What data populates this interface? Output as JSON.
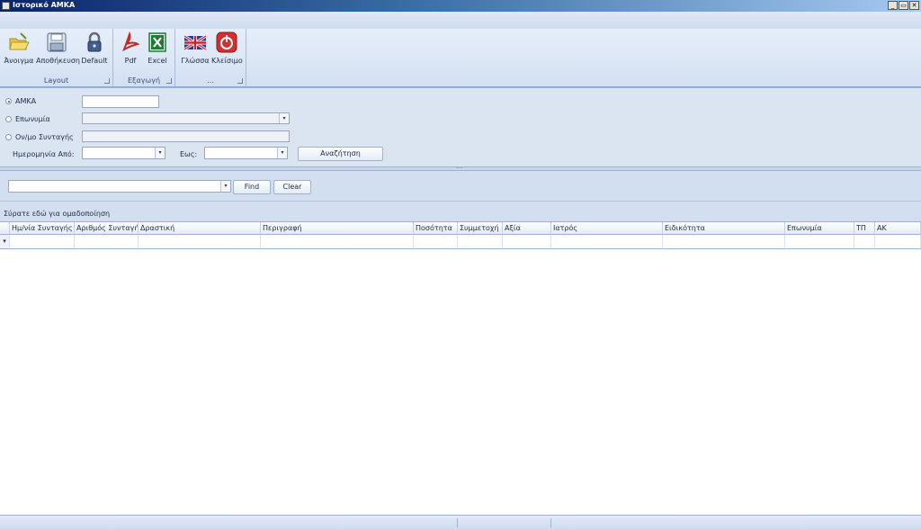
{
  "window": {
    "title": "Ιστορικό ΑΜΚΑ",
    "controls": [
      "_",
      "▭",
      "✕"
    ]
  },
  "ribbon": {
    "groups": [
      {
        "label": "Layout",
        "buttons": [
          {
            "label": "Άνοιγμα",
            "icon": "folder-open-icon"
          },
          {
            "label": "Αποθήκευση",
            "icon": "floppy-disk-icon"
          },
          {
            "label": "Default",
            "icon": "padlock-icon"
          }
        ]
      },
      {
        "label": "Εξαγωγή",
        "buttons": [
          {
            "label": "Pdf",
            "icon": "pdf-icon"
          },
          {
            "label": "Excel",
            "icon": "excel-icon"
          }
        ]
      },
      {
        "label": "...",
        "buttons": [
          {
            "label": "Γλώσσα",
            "icon": "uk-flag-icon"
          },
          {
            "label": "Κλείσιμο",
            "icon": "power-off-icon"
          }
        ]
      }
    ]
  },
  "search": {
    "amka_label": "ΑΜΚΑ",
    "amka_value": "",
    "name_label": "Επωνυμία",
    "prescription_label": "Ον/μο Συνταγής",
    "date_from_label": "Ημερομηνία Από:",
    "date_to_label": "Εως:",
    "search_button": "Αναζήτηση",
    "selected": "amka"
  },
  "findbar": {
    "find_value": "",
    "find_button": "Find",
    "clear_button": "Clear"
  },
  "grid": {
    "group_hint": "Σύρατε εδώ για ομαδοποίηση",
    "sorted_column": "Ημ/νία Συνταγής",
    "columns": [
      "Ημ/νία Συνταγής",
      "Αριθμός Συνταγής",
      "Δραστική",
      "Περιγραφή",
      "Ποσότητα",
      "Συμμετοχή",
      "Αξία",
      "Ιατρός",
      "Ειδικότητα",
      "Επωνυμία",
      "ΤΠ",
      "ΑΚ"
    ]
  },
  "colors": {
    "title_start": "#0a246a",
    "pdf_red": "#c62828",
    "excel_green": "#1e7a34",
    "close_red": "#d32f2f"
  }
}
